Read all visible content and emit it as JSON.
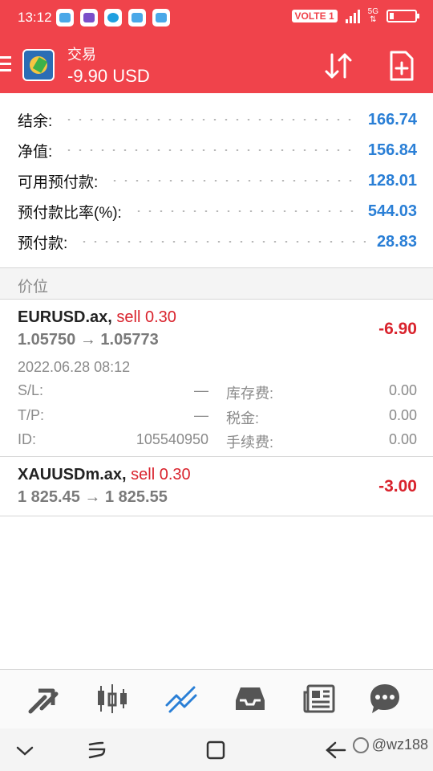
{
  "status_bar": {
    "time": "13:12",
    "volte": "VOLTE 1",
    "network": "5G",
    "app_icons": [
      "notification-app-1-icon",
      "gallery-icon",
      "chat-app-icon",
      "notification-app-2-icon",
      "notification-app-3-icon"
    ]
  },
  "header": {
    "title": "交易",
    "subtitle": "-9.90 USD",
    "accent_color": "#f0434b"
  },
  "account": {
    "rows": [
      {
        "label": "结余:",
        "value": "166.74"
      },
      {
        "label": "净值:",
        "value": "156.84"
      },
      {
        "label": "可用预付款:",
        "value": "128.01"
      },
      {
        "label": "预付款比率(%):",
        "value": "544.03"
      },
      {
        "label": "预付款:",
        "value": "28.83"
      }
    ],
    "value_color": "#2a7fd6"
  },
  "section_header": "价位",
  "positions": [
    {
      "symbol": "EURUSD.ax,",
      "side": "sell 0.30",
      "prices": "1.05750 → 1.05773",
      "profit": "-6.90",
      "open_time": "2022.06.28 08:12",
      "details": [
        {
          "k1": "S/L:",
          "v1": "—",
          "k2": "库存费:",
          "v2": "0.00"
        },
        {
          "k1": "T/P:",
          "v1": "—",
          "k2": "税金:",
          "v2": "0.00"
        },
        {
          "k1": "ID:",
          "v1": "105540950",
          "k2": "手续费:",
          "v2": "0.00"
        }
      ]
    },
    {
      "symbol": "XAUUSDm.ax,",
      "side": "sell 0.30",
      "prices": "1 825.45 → 1 825.55",
      "profit": "-3.00"
    }
  ],
  "bottom_nav": {
    "items": [
      "quotes-icon",
      "chart-icon",
      "trade-icon",
      "history-icon",
      "news-icon",
      "chat-icon"
    ],
    "active": "trade-icon",
    "active_color": "#2a7fd6"
  },
  "system_nav": {
    "watermark": "@wz188"
  }
}
